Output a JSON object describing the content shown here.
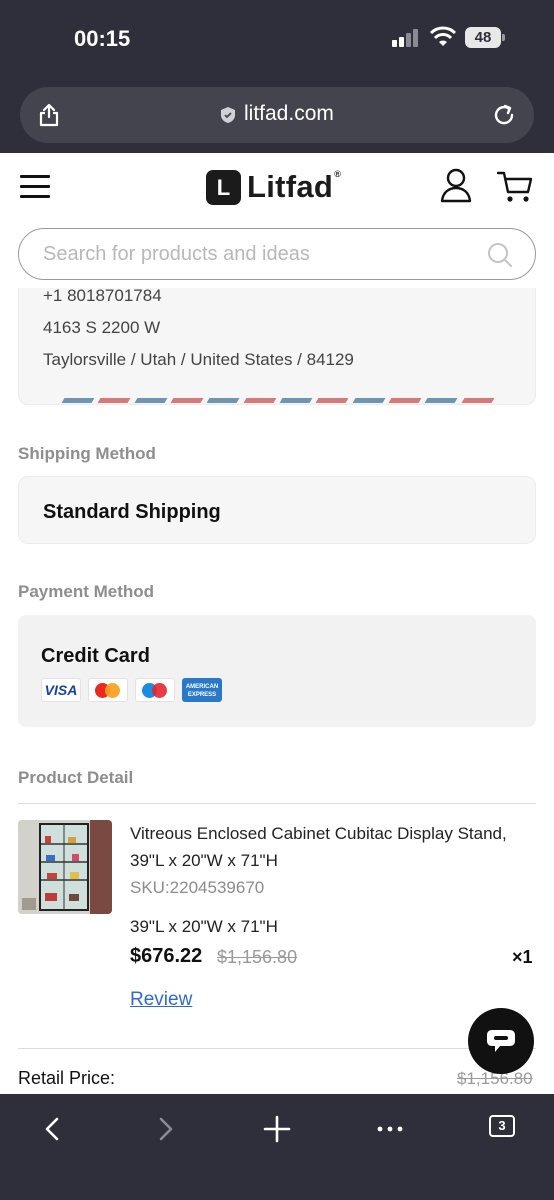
{
  "status_bar": {
    "time": "00:15",
    "battery": "48"
  },
  "browser": {
    "url": "litfad.com",
    "tab_count": "3"
  },
  "site": {
    "logo_letter": "L",
    "logo_name": "Litfad",
    "logo_reg": "®",
    "search_placeholder": "Search for products and ideas"
  },
  "address": {
    "phone": "+1 8018701784",
    "street": "4163 S 2200 W",
    "city_line": "Taylorsville / Utah / United States / 84129"
  },
  "shipping": {
    "section_title": "Shipping Method",
    "method": "Standard Shipping"
  },
  "payment": {
    "section_title": "Payment Method",
    "method": "Credit Card",
    "cards": [
      "visa",
      "mastercard",
      "maestro",
      "american-express"
    ],
    "visa_label": "VISA",
    "amex_label_1": "AMERICAN",
    "amex_label_2": "EXPRESS"
  },
  "product_detail": {
    "section_title": "Product Detail",
    "name": "Vitreous Enclosed Cabinet Cubitac Display Stand, 39\"L x 20\"W x 71\"H",
    "sku": "SKU:2204539670",
    "size": "39\"L x 20\"W x 71\"H",
    "price": "$676.22",
    "original_price": "$1,156.80",
    "quantity": "×1",
    "review_label": "Review"
  },
  "summary": {
    "retail_label": "Retail Price:",
    "retail_value": "$1,156.80"
  },
  "colors": {
    "chrome_bg": "#2f2f3b",
    "url_bar_bg": "#44444f",
    "link_blue": "#2e6ad6",
    "airmail_blue": "#6f95b0",
    "airmail_red": "#d47a7a"
  }
}
